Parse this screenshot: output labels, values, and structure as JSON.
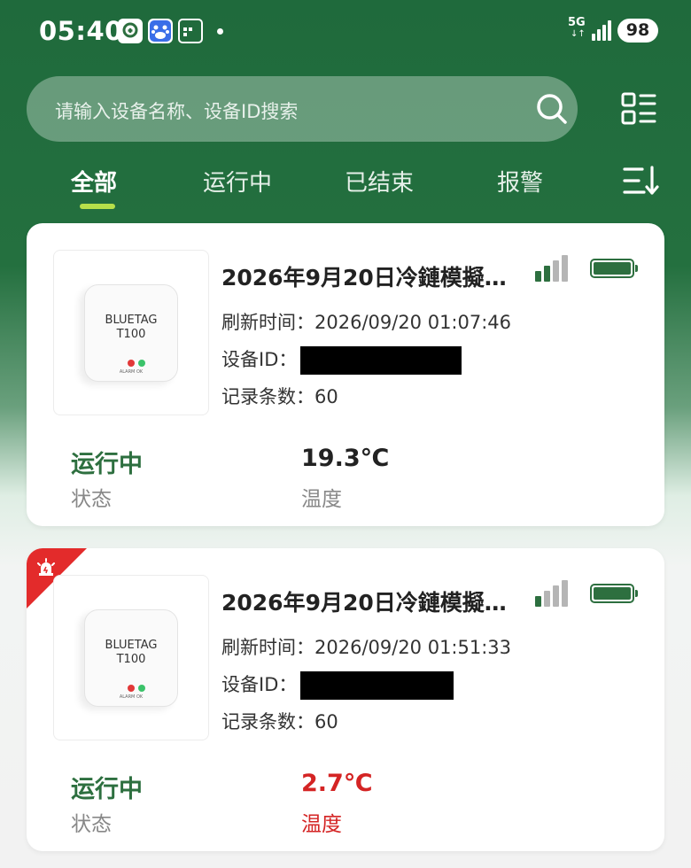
{
  "status_bar": {
    "time": "05:40",
    "network": "5G",
    "network_arrows": "↓↑",
    "battery": "98"
  },
  "search": {
    "placeholder": "请输入设备名称、设备ID搜索"
  },
  "tabs": [
    {
      "label": "全部",
      "active": true
    },
    {
      "label": "运行中",
      "active": false
    },
    {
      "label": "已结束",
      "active": false
    },
    {
      "label": "报警",
      "active": false
    }
  ],
  "devices": [
    {
      "title": "2026年9月20日冷鏈模擬…",
      "device_brand": "BLUETAG",
      "device_model": "T100",
      "device_caption": "ALARM OK",
      "refresh_label": "刷新时间：",
      "refresh_time": "2026/09/20 01:07:46",
      "id_label": "设备ID：",
      "record_label": "记录条数：",
      "record_count": "60",
      "status_value": "运行中",
      "status_label": "状态",
      "temp_value": "19.3℃",
      "temp_label": "温度",
      "alarm": false,
      "temp_color": "#222222",
      "signal_bars_active": 2,
      "signal_bars_total": 4
    },
    {
      "title": "2026年9月20日冷鏈模擬…",
      "device_brand": "BLUETAG",
      "device_model": "T100",
      "device_caption": "ALARM OK",
      "refresh_label": "刷新时间：",
      "refresh_time": "2026/09/20 01:51:33",
      "id_label": "设备ID：",
      "record_label": "记录条数：",
      "record_count": "60",
      "status_value": "运行中",
      "status_label": "状态",
      "temp_value": "2.7℃",
      "temp_label": "温度",
      "alarm": true,
      "temp_color": "#d42424",
      "signal_bars_active": 1,
      "signal_bars_total": 4
    }
  ],
  "colors": {
    "brand_green": "#2d6f3f",
    "tab_indicator": "#b7e04a",
    "alarm_red": "#e32b2b"
  }
}
